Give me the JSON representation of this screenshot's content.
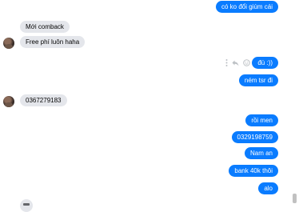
{
  "messages": [
    {
      "direction": "out",
      "text": "có ko đổi giùm cái"
    },
    {
      "direction": "in",
      "text": "Mới comback"
    },
    {
      "direction": "in",
      "text": "Free phí luôn haha"
    },
    {
      "direction": "out",
      "text": "đù :))"
    },
    {
      "direction": "out",
      "text": "ném tsr đi"
    },
    {
      "direction": "in",
      "text": "0367279183"
    },
    {
      "direction": "out",
      "text": "rồi men"
    },
    {
      "direction": "out",
      "text": "0329198759"
    },
    {
      "direction": "out",
      "text": "Nam an"
    },
    {
      "direction": "out",
      "text": "bank 40k thôi"
    },
    {
      "direction": "out",
      "text": "alo"
    }
  ],
  "hover_actions": {
    "icons": [
      "more-icon",
      "reply-icon",
      "emoji-react-icon"
    ]
  },
  "colors": {
    "outgoing": "#0a7cff",
    "incoming": "#e4e6eb",
    "icons": "#bcc0c4"
  }
}
